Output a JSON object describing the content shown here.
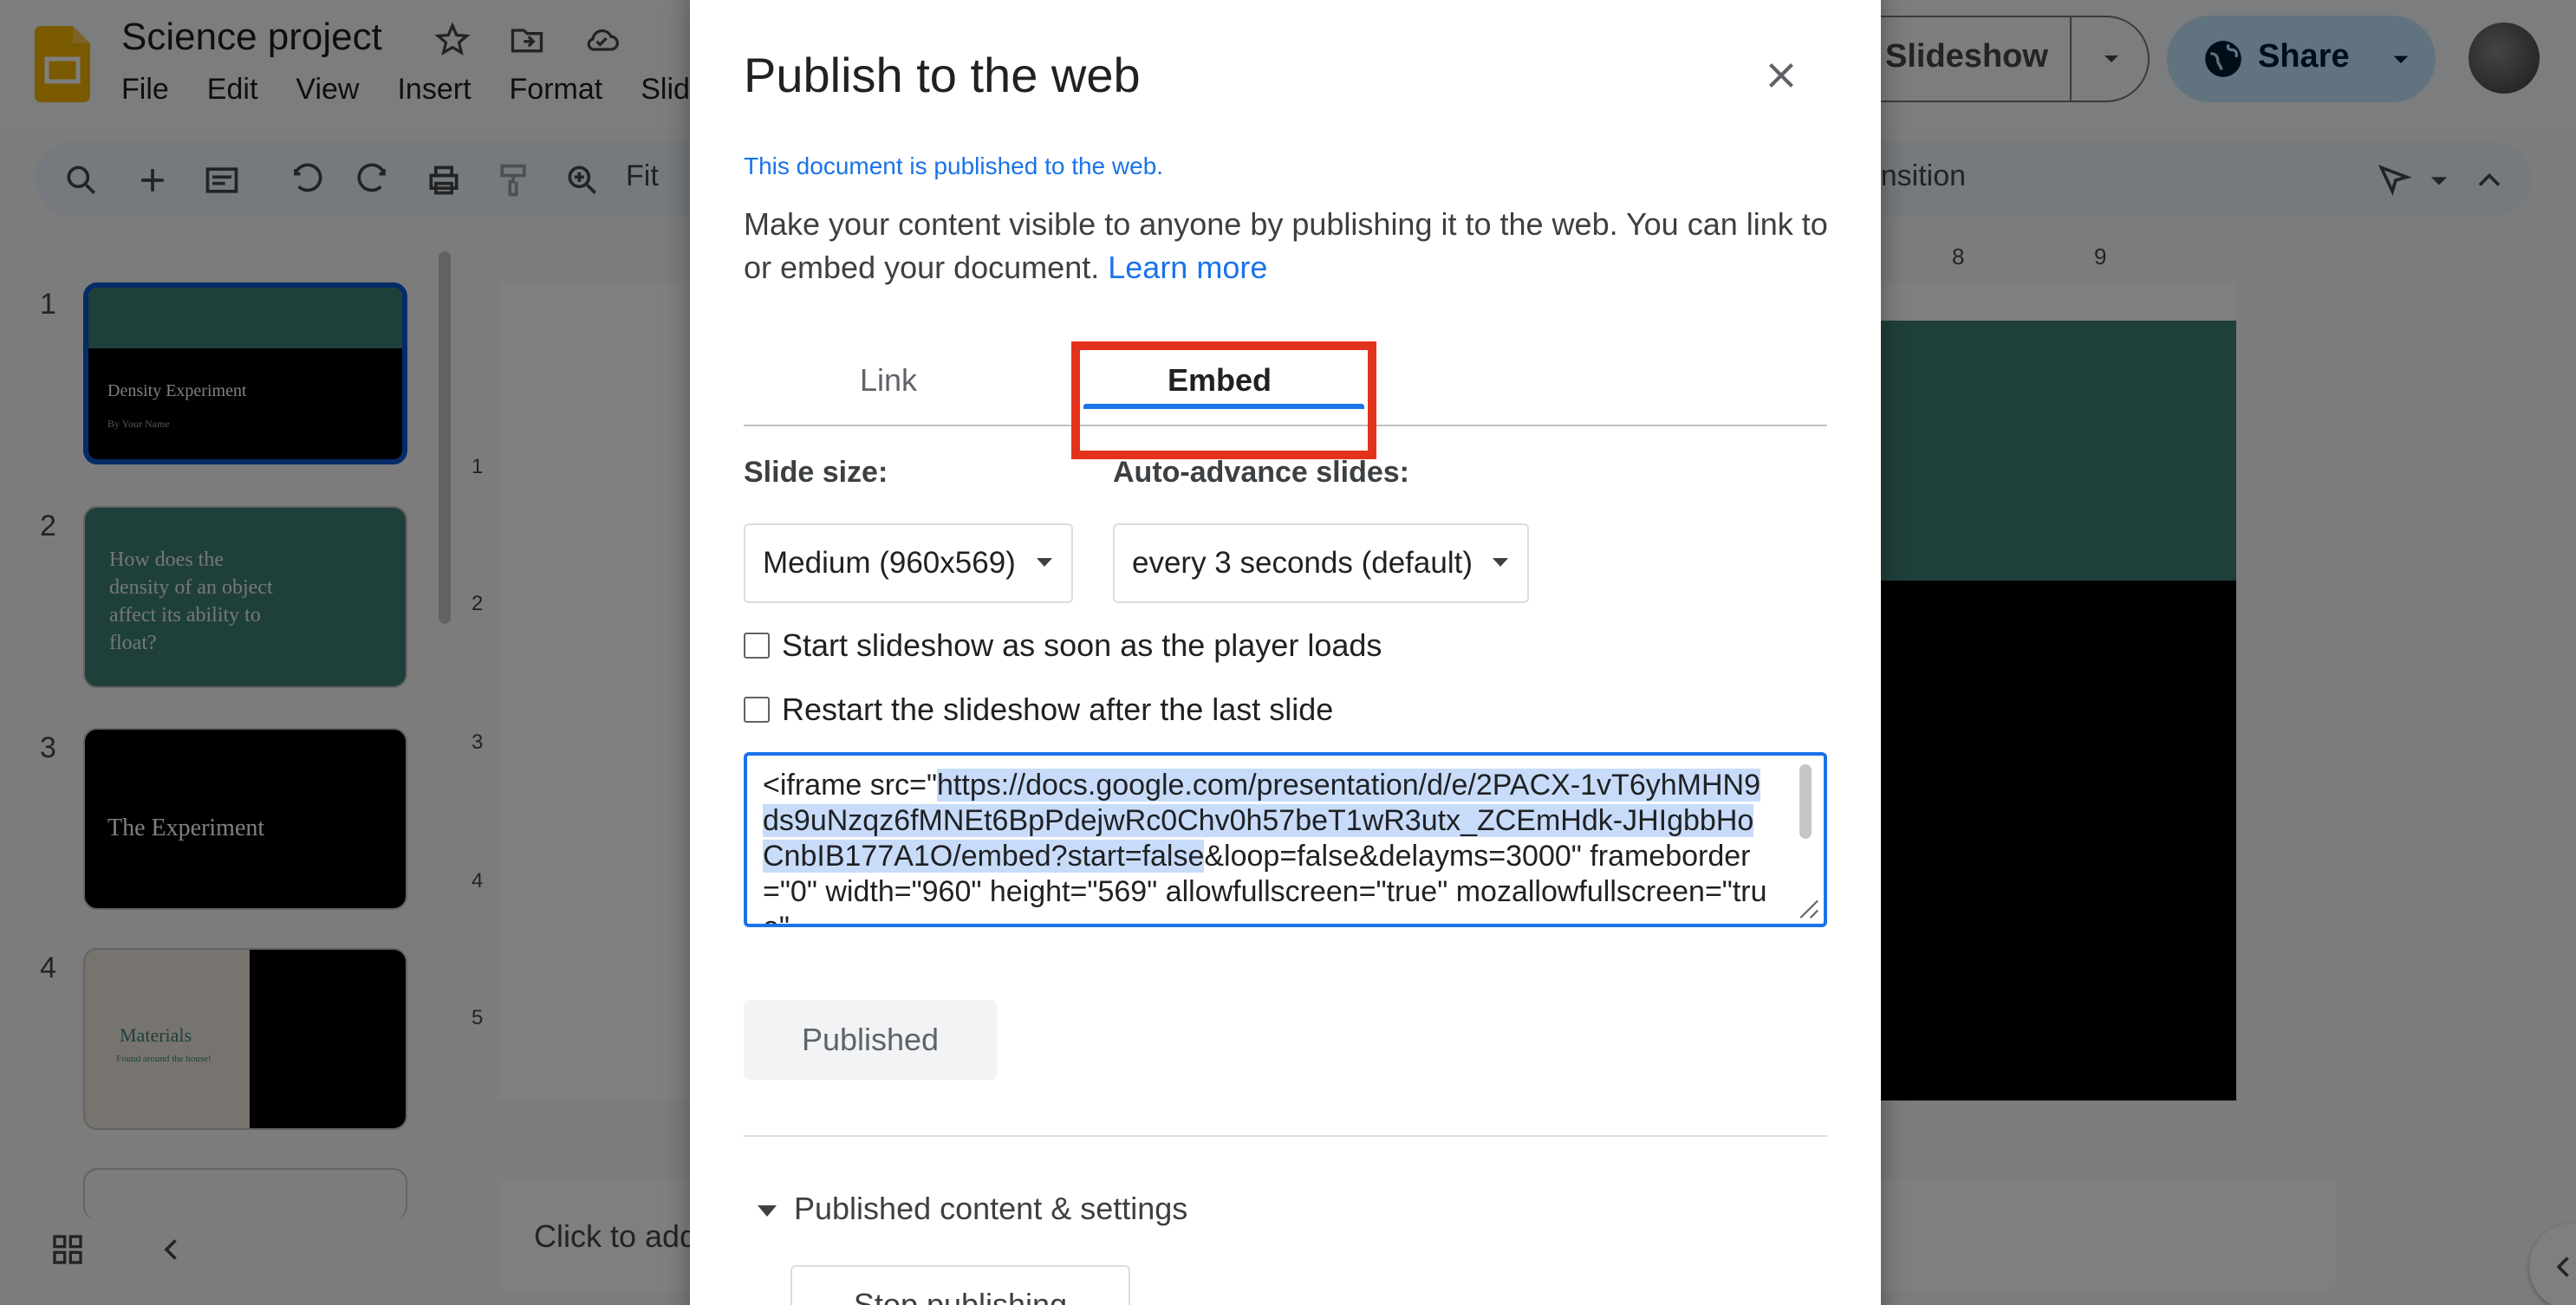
{
  "app": {
    "doc_title": "Science project",
    "menu": [
      "File",
      "Edit",
      "View",
      "Insert",
      "Format",
      "Slide"
    ],
    "toolbar_zoom": "Fit",
    "toolbar_transition": "Transition",
    "slideshow_label": "Slideshow",
    "share_label": "Share"
  },
  "filmstrip": {
    "slides": [
      {
        "num": "1",
        "title": "Density Experiment",
        "subtitle": "By Your Name"
      },
      {
        "num": "2",
        "title": "How does the density of an object affect its ability to float?"
      },
      {
        "num": "3",
        "title": "The Experiment"
      },
      {
        "num": "4",
        "title": "Materials",
        "subtitle": "Found around the house!"
      }
    ]
  },
  "rulers": {
    "vertical": [
      "1",
      "2",
      "3",
      "4",
      "5"
    ],
    "horizontal": [
      "8",
      "9"
    ]
  },
  "notes_placeholder": "Click to add speaker notes",
  "dialog": {
    "title": "Publish to the web",
    "status": "This document is published to the web.",
    "description": "Make your content visible to anyone by publishing it to the web. You can link to or embed your document.",
    "learn_more": "Learn more",
    "tabs": [
      {
        "label": "Link",
        "active": false
      },
      {
        "label": "Embed",
        "active": true
      }
    ],
    "slide_size_label": "Slide size:",
    "slide_size_value": "Medium (960x569)",
    "auto_advance_label": "Auto-advance slides:",
    "auto_advance_value": "every 3 seconds (default)",
    "checkbox_start": "Start slideshow as soon as the player loads",
    "checkbox_restart": "Restart the slideshow after the last slide",
    "embed_prefix": "<iframe src=\"",
    "embed_selected": "https://docs.google.com/presentation/d/e/2PACX-1vT6yhMHN9ds9uNzqz6fMNEt6BpPdejwRc0Chv0h57beT1wR3utx_ZCEmHdk-JHIgbbHoCnbIB177A1O/embed?start=false",
    "embed_suffix": "&loop=false&delayms=3000\" frameborder=\"0\" width=\"960\" height=\"569\" allowfullscreen=\"true\" mozallowfullscreen=\"true\"",
    "published_label": "Published",
    "published_settings_label": "Published content & settings",
    "stop_publishing_label": "Stop publishing"
  },
  "colors": {
    "accent": "#1a73e8",
    "highlight": "#e3321c",
    "teal": "#3f7e76"
  }
}
